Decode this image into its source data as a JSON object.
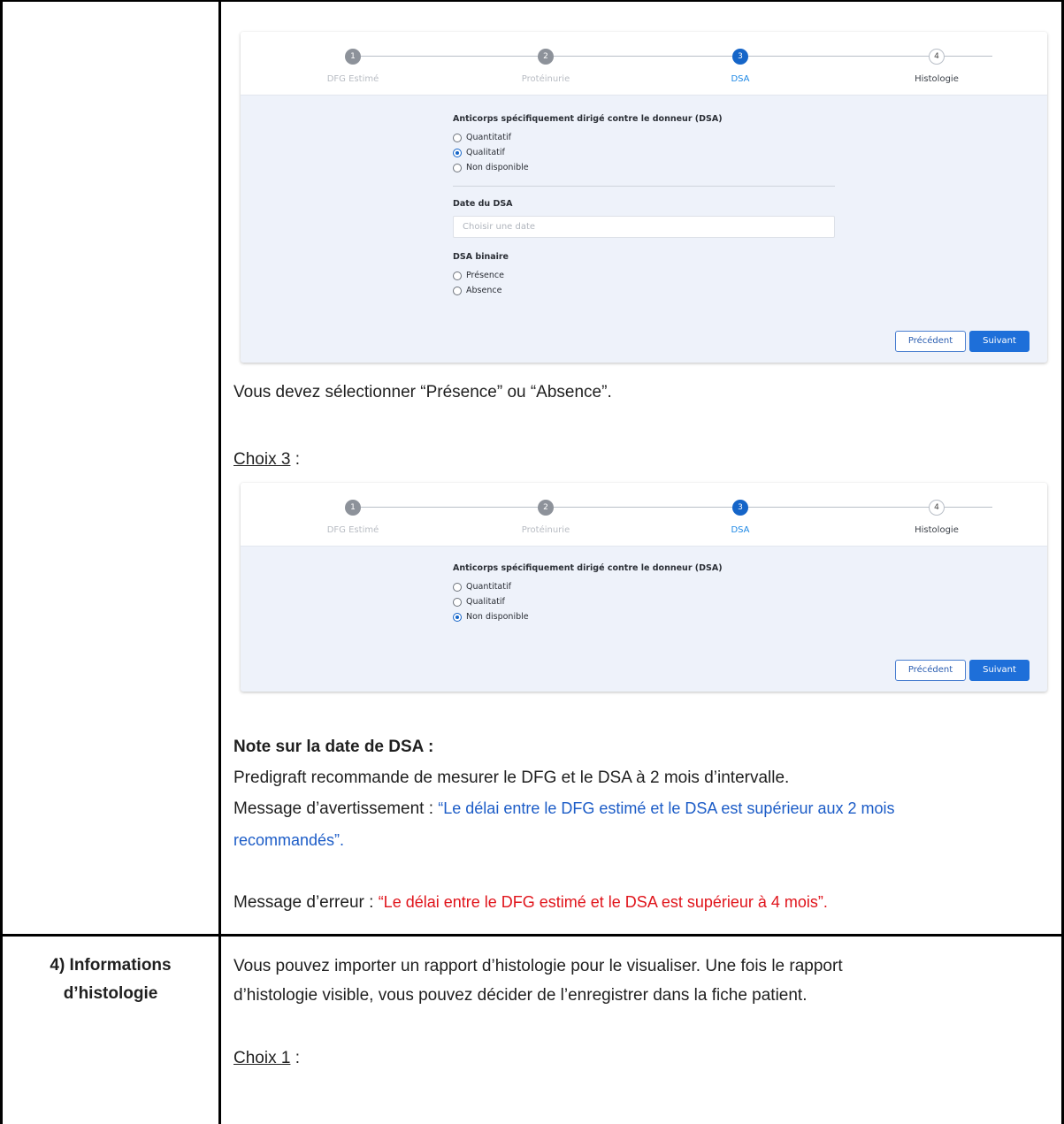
{
  "panel1": {
    "steps": [
      {
        "num": "1",
        "label": "DFG Estimé"
      },
      {
        "num": "2",
        "label": "Protéinurie"
      },
      {
        "num": "3",
        "label": "DSA"
      },
      {
        "num": "4",
        "label": "Histologie"
      }
    ],
    "dsa_title": "Anticorps spécifiquement dirigé contre le donneur (DSA)",
    "dsa_options": [
      "Quantitatif",
      "Qualitatif",
      "Non disponible"
    ],
    "dsa_selected": "Qualitatif",
    "date_label": "Date du DSA",
    "date_placeholder": "Choisir une date",
    "binary_label": "DSA binaire",
    "binary_options": [
      "Présence",
      "Absence"
    ],
    "prev_button": "Précédent",
    "next_button": "Suivant"
  },
  "text_select": "Vous devez sélectionner “Présence” ou “Absence”.",
  "choice3": {
    "label": "Choix 3",
    "suffix": " :"
  },
  "panel2": {
    "steps": [
      {
        "num": "1",
        "label": "DFG Estimé"
      },
      {
        "num": "2",
        "label": "Protéinurie"
      },
      {
        "num": "3",
        "label": "DSA"
      },
      {
        "num": "4",
        "label": "Histologie"
      }
    ],
    "dsa_title": "Anticorps spécifiquement dirigé contre le donneur (DSA)",
    "dsa_options": [
      "Quantitatif",
      "Qualitatif",
      "Non disponible"
    ],
    "dsa_selected": "Non disponible",
    "prev_button": "Précédent",
    "next_button": "Suivant"
  },
  "note": {
    "title": "Note sur la date de DSA :",
    "line1": "Predigraft recommande de mesurer le DFG et le DSA à 2 mois d’intervalle.",
    "warning_prefix": "Message d’avertissement : ",
    "warning_line1": "“Le délai entre le DFG estimé et le DSA est supérieur aux 2 mois",
    "warning_line2": "recommandés”.",
    "error_prefix": "Message d’erreur : ",
    "error_text": "“Le délai entre le DFG estimé et le DSA est supérieur à 4 mois”."
  },
  "section4": {
    "heading_line1": "4) Informations",
    "heading_line2": "d’histologie",
    "para_line1": "Vous pouvez importer un rapport d’histologie pour le visualiser. Une fois le rapport",
    "para_line2": "d’histologie visible, vous pouvez décider de l’enregistrer dans la fiche patient.",
    "choice1_label": "Choix 1",
    "choice1_suffix": " :"
  },
  "colors": {
    "active_step": "#1565c8",
    "warning": "#1c5cc7",
    "error": "#e0141b"
  }
}
